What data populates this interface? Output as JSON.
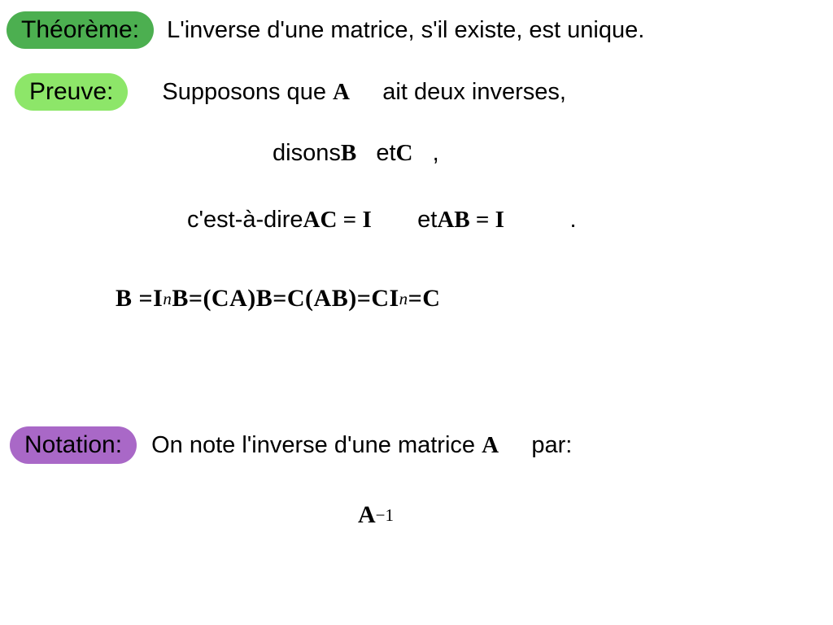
{
  "theorem": {
    "label": "Théorème:",
    "text": "L'inverse d'une matrice, s'il existe, est unique."
  },
  "proof": {
    "label": "Preuve:",
    "line1_a": "Supposons que",
    "line1_A": "A",
    "line1_b": "ait deux inverses,",
    "line2_a": "disons",
    "line2_B": "B",
    "line2_b": "et",
    "line2_C": "C",
    "line2_c": ",",
    "line3_a": "c'est-à-dire",
    "line3_eq1": "AC = I",
    "line3_b": "et",
    "line3_eq2": "AB = I",
    "line3_c": ".",
    "chain_B": "B",
    "chain_eq1": " = ",
    "chain_InB_I": "I",
    "chain_InB_n": "n",
    "chain_InB_B": "B",
    "chain_eq2": " = ",
    "chain_CAB1": "(CA)B",
    "chain_eq3": " = ",
    "chain_CAB2": "C(AB)",
    "chain_eq4": " = ",
    "chain_CI_C": "CI",
    "chain_CI_n": "n",
    "chain_eq5": " = ",
    "chain_C": "C"
  },
  "notation": {
    "label": "Notation:",
    "text_a": "On note l'inverse d'une matrice",
    "text_A": "A",
    "text_b": "par:",
    "inv_A": "A",
    "inv_exp": "−1"
  }
}
